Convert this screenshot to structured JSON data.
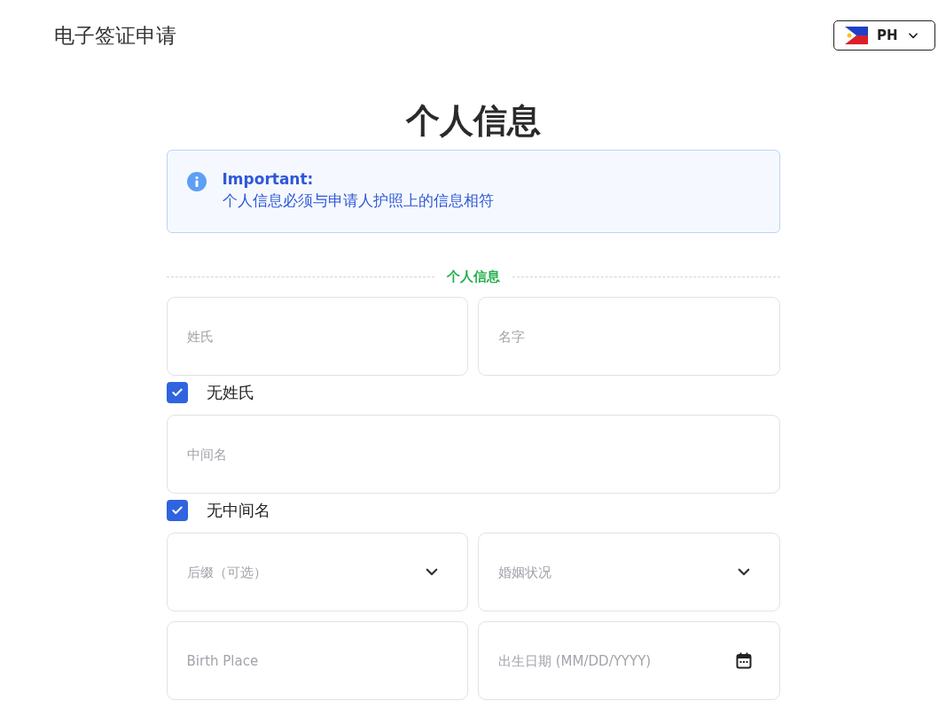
{
  "header": {
    "title": "电子签证申请",
    "language": {
      "code": "PH"
    }
  },
  "page_title": "个人信息",
  "notice": {
    "heading": "Important:",
    "text": "个人信息必须与申请人护照上的信息相符"
  },
  "section": {
    "title": "个人信息"
  },
  "form_rows": [
    {
      "kind": "fields",
      "fields": [
        {
          "kind": "text",
          "placeholder": "姓氏"
        },
        {
          "kind": "text",
          "placeholder": "名字"
        }
      ]
    },
    {
      "kind": "checkbox",
      "label": "无姓氏",
      "checked": true
    },
    {
      "kind": "fields",
      "fields": [
        {
          "kind": "text",
          "placeholder": "中间名"
        }
      ]
    },
    {
      "kind": "checkbox",
      "label": "无中间名",
      "checked": true
    },
    {
      "kind": "fields",
      "fields": [
        {
          "kind": "select",
          "placeholder": "后缀（可选）"
        },
        {
          "kind": "select",
          "placeholder": "婚姻状况"
        }
      ]
    },
    {
      "kind": "fields",
      "fields": [
        {
          "kind": "text",
          "placeholder": "Birth Place"
        },
        {
          "kind": "date",
          "placeholder": "出生日期 (MM/DD/YYYY)"
        }
      ]
    }
  ]
}
